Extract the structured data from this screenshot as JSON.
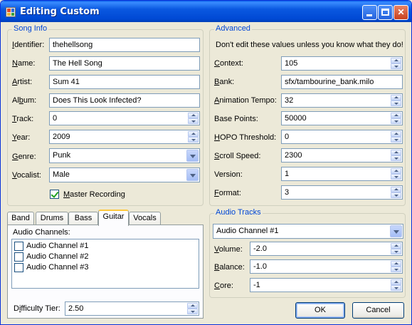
{
  "window": {
    "title": "Editing Custom"
  },
  "song_info": {
    "title": "Song Info",
    "fields": {
      "identifier": {
        "label_hot": "I",
        "label_rest": "dentifier:",
        "value": "thehellsong"
      },
      "name": {
        "label_hot": "N",
        "label_rest": "ame:",
        "value": "The Hell Song"
      },
      "artist": {
        "label_hot": "A",
        "label_rest": "rtist:",
        "value": "Sum 41"
      },
      "album": {
        "label_pre": "Al",
        "label_hot": "b",
        "label_rest": "um:",
        "value": "Does This Look Infected?"
      },
      "track": {
        "label_hot": "T",
        "label_rest": "rack:",
        "value": "0"
      },
      "year": {
        "label_hot": "Y",
        "label_rest": "ear:",
        "value": "2009"
      },
      "genre": {
        "label_hot": "G",
        "label_rest": "enre:",
        "value": "Punk"
      },
      "vocalist": {
        "label_hot": "V",
        "label_rest": "ocalist:",
        "value": "Male"
      }
    },
    "master_recording": {
      "label_hot": "M",
      "label_rest": "aster Recording",
      "checked": true
    }
  },
  "advanced": {
    "title": "Advanced",
    "note": "Don't edit these values unless you know what they do!",
    "fields": {
      "context": {
        "label_hot": "C",
        "label_rest": "ontext:",
        "value": "105"
      },
      "bank": {
        "label_hot": "B",
        "label_rest": "ank:",
        "value": "sfx/tambourine_bank.milo"
      },
      "animation_tempo": {
        "label_hot": "A",
        "label_rest": "nimation Tempo:",
        "value": "32"
      },
      "base_points": {
        "label": "Base Points:",
        "value": "50000"
      },
      "hopo_threshold": {
        "label_hot": "H",
        "label_rest": "OPO Threshold:",
        "value": "0"
      },
      "scroll_speed": {
        "label_hot": "S",
        "label_rest": "croll Speed:",
        "value": "2300"
      },
      "version": {
        "label": "Version:",
        "value": "1"
      },
      "format": {
        "label_hot": "F",
        "label_rest": "ormat:",
        "value": "3"
      }
    }
  },
  "tabs": {
    "items": [
      "Band",
      "Drums",
      "Bass",
      "Guitar",
      "Vocals"
    ],
    "active": "Guitar",
    "audio_channels_label": "Audio Channels:",
    "channels": [
      {
        "label": "Audio Channel #1",
        "checked": false
      },
      {
        "label": "Audio Channel #2",
        "checked": false
      },
      {
        "label": "Audio Channel #3",
        "checked": false
      }
    ],
    "difficulty": {
      "label_pre": "D",
      "label_hot": "i",
      "label_rest": "fficulty Tier:",
      "value": "2.50"
    }
  },
  "audio_tracks": {
    "title": "Audio Tracks",
    "selected": "Audio Channel #1",
    "volume": {
      "label_hot": "V",
      "label_rest": "olume:",
      "value": "-2.0"
    },
    "balance": {
      "label_hot": "B",
      "label_rest": "alance:",
      "value": "-1.0"
    },
    "core": {
      "label_hot": "C",
      "label_rest": "ore:",
      "value": "-1"
    }
  },
  "buttons": {
    "ok": "OK",
    "cancel": "Cancel"
  }
}
